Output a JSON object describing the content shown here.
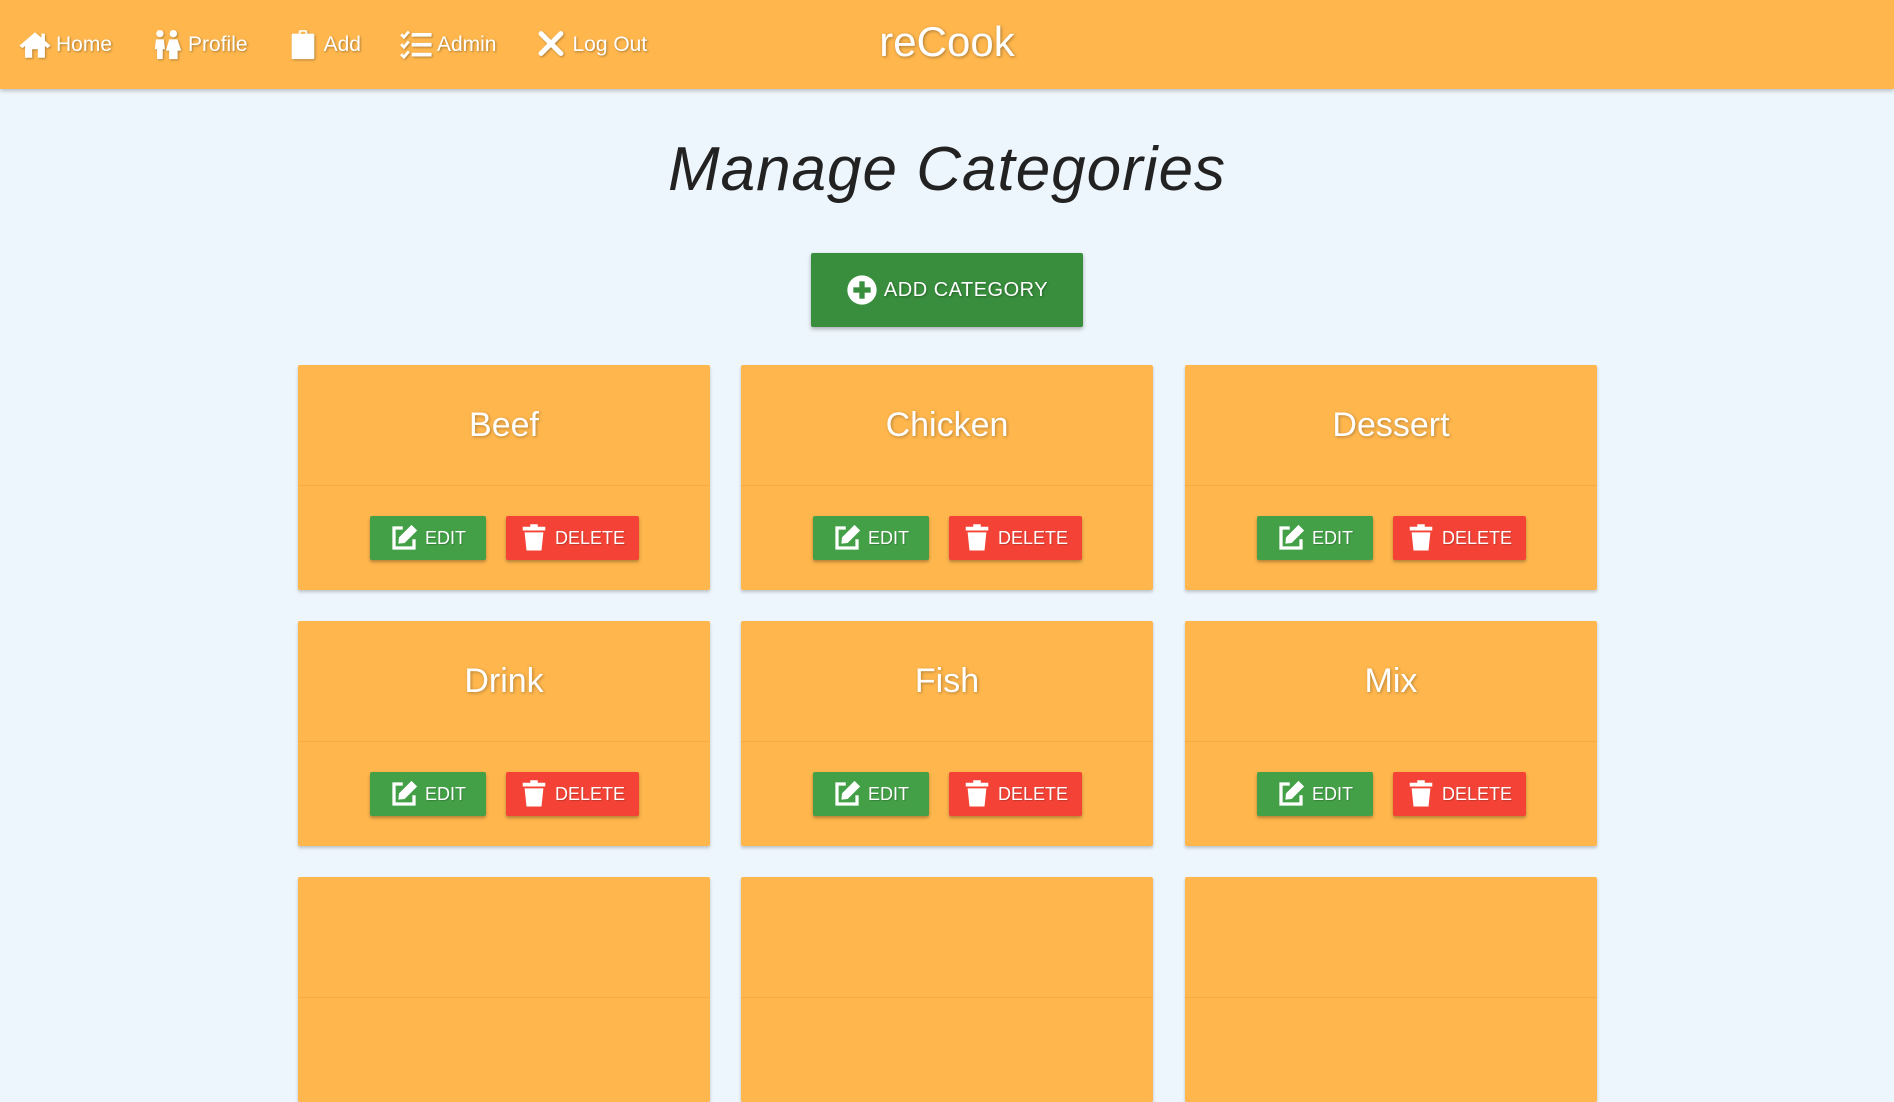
{
  "nav": {
    "items": [
      {
        "label": "Home",
        "icon": "home-icon"
      },
      {
        "label": "Profile",
        "icon": "people-icon"
      },
      {
        "label": "Add",
        "icon": "clipboard-icon"
      },
      {
        "label": "Admin",
        "icon": "checklist-icon"
      },
      {
        "label": "Log Out",
        "icon": "close-icon"
      }
    ],
    "brand": "reCook"
  },
  "page": {
    "title": "Manage Categories",
    "add_button_label": "ADD CATEGORY"
  },
  "categories": [
    {
      "name": "Beef",
      "edit_label": "EDIT",
      "delete_label": "DELETE"
    },
    {
      "name": "Chicken",
      "edit_label": "EDIT",
      "delete_label": "DELETE"
    },
    {
      "name": "Dessert",
      "edit_label": "EDIT",
      "delete_label": "DELETE"
    },
    {
      "name": "Drink",
      "edit_label": "EDIT",
      "delete_label": "DELETE"
    },
    {
      "name": "Fish",
      "edit_label": "EDIT",
      "delete_label": "DELETE"
    },
    {
      "name": "Mix",
      "edit_label": "EDIT",
      "delete_label": "DELETE"
    },
    {
      "name": "",
      "edit_label": "",
      "delete_label": ""
    },
    {
      "name": "",
      "edit_label": "",
      "delete_label": ""
    },
    {
      "name": "",
      "edit_label": "",
      "delete_label": ""
    }
  ],
  "colors": {
    "navbar": "#ffb74d",
    "background": "#eef6fd",
    "card": "#ffb74d",
    "add_button": "#388e3c",
    "edit_button": "#43a047",
    "delete_button": "#f44336"
  }
}
